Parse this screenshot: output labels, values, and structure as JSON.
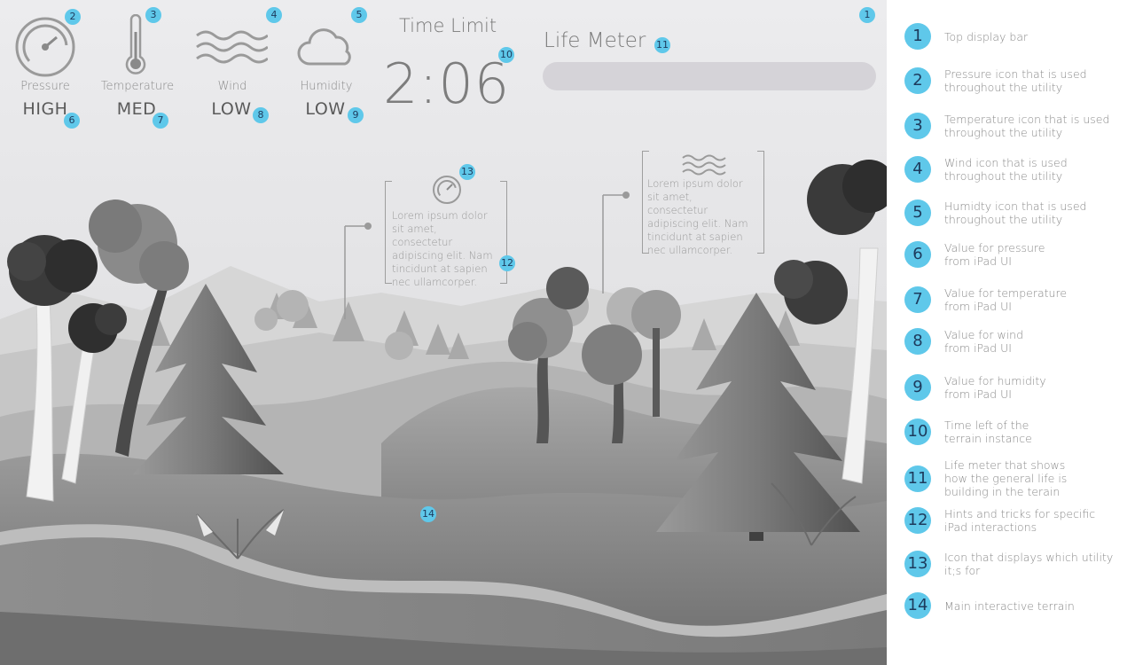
{
  "hud": {
    "stats": [
      {
        "label": "Pressure",
        "value": "HIGH",
        "icon": "pressure-gauge-icon"
      },
      {
        "label": "Temperature",
        "value": "MED",
        "icon": "thermometer-icon"
      },
      {
        "label": "Wind",
        "value": "LOW",
        "icon": "wind-waves-icon"
      },
      {
        "label": "Humidity",
        "value": "LOW",
        "icon": "cloud-icon"
      }
    ],
    "time_title": "Time Limit",
    "time_value": "2:06",
    "life_title": "Life Meter"
  },
  "hints": [
    {
      "text": "Lorem ipsum dolor sit amet, consectetur adipiscing elit. Nam tincidunt at sapien nec ullamcorper.",
      "icon": "pressure-gauge-icon"
    },
    {
      "text": "Lorem ipsum dolor sit amet, consectetur adipiscing elit. Nam tincidunt at sapien nec ullamcorper.",
      "icon": "wind-waves-icon"
    }
  ],
  "badges": [
    "1",
    "2",
    "3",
    "4",
    "5",
    "6",
    "7",
    "8",
    "9",
    "10",
    "11",
    "12",
    "13",
    "14"
  ],
  "legend": [
    {
      "num": "1",
      "text": "Top display bar"
    },
    {
      "num": "2",
      "text": "Pressure icon that is used\nthroughout the utility"
    },
    {
      "num": "3",
      "text": "Temperature icon that is used\nthroughout the utility"
    },
    {
      "num": "4",
      "text": "Wind icon that is used\nthroughout the utility"
    },
    {
      "num": "5",
      "text": "Humidty icon that is used\nthroughout the utility"
    },
    {
      "num": "6",
      "text": "Value for pressure\nfrom iPad UI"
    },
    {
      "num": "7",
      "text": "Value for temperature\nfrom iPad UI"
    },
    {
      "num": "8",
      "text": "Value for wind\nfrom iPad UI"
    },
    {
      "num": "9",
      "text": "Value for humidity\nfrom iPad UI"
    },
    {
      "num": "10",
      "text": "Time left of the\nterrain instance"
    },
    {
      "num": "11",
      "text": "Life meter that shows\nhow the general life is\nbuilding in the terain"
    },
    {
      "num": "12",
      "text": "Hints and tricks for specific\niPad interactions"
    },
    {
      "num": "13",
      "text": "Icon that displays which utility\nit;s for"
    },
    {
      "num": "14",
      "text": "Main interactive terrain"
    }
  ],
  "colors": {
    "badge": "#5fc8ea",
    "badge_text": "#1d3a5c",
    "hud_text": "#7a7a7a",
    "life_bar": "#d5d3d8"
  }
}
